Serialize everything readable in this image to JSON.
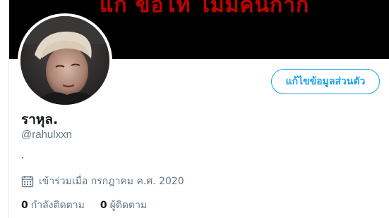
{
  "banner": {
    "text": "แก ขอโท ไม่มีคนกาก",
    "text_color": "#c40000"
  },
  "profile": {
    "display_name": "ราหุล.",
    "handle": "@rahulxxn",
    "bio": ".",
    "joined_text": "เข้าร่วมเมื่อ กรกฎาคม ค.ศ. 2020",
    "joined_icon": "calendar-icon"
  },
  "actions": {
    "edit_profile_label": "แก้ไขข้อมูลส่วนตัว"
  },
  "stats": {
    "following_count": "0",
    "following_label": "กำลังติดตาม",
    "followers_count": "0",
    "followers_label": "ผู้ติดตาม"
  },
  "colors": {
    "accent": "#1da1f2",
    "secondary_text": "#657786",
    "primary_text": "#14171a",
    "banner_bg": "#000000"
  }
}
